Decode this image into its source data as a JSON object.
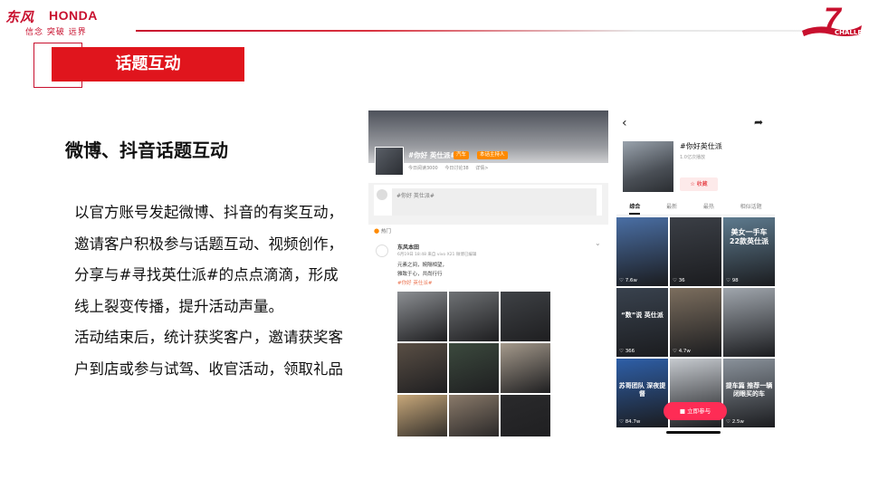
{
  "header": {
    "brand_cn": "东风",
    "brand_en": "HONDA",
    "slogan": "信念 突破 远界",
    "badge_number": "7",
    "badge_text": "CHALLENGE",
    "colors": {
      "brand_red": "#c8102e",
      "title_bar": "#e0151d"
    }
  },
  "title": {
    "label": "话题互动"
  },
  "content": {
    "subtitle": "微博、抖音话题互动",
    "paragraph1": "以官方账号发起微博、抖音的有奖互动，邀请客户积极参与话题互动、视频创作，分享与#寻找英仕派#的点点滴滴，形成线上裂变传播，提升活动声量。",
    "paragraph2": "活动结束后，统计获奖客户，邀请获奖客户到店或参与试驾、收官活动，领取礼品"
  },
  "weibo": {
    "topic": "#你好 英仕派#",
    "tag1": "汽车",
    "tag2": "本话主持人",
    "stats": "今日阅读3000 今日讨论38 详情>",
    "input_placeholder": "#你好 英仕派#",
    "hot_label": "热门",
    "post_user": "东风本田",
    "post_meta": "6月19日 18:48 来自 vivo X21 微博已编辑",
    "post_line1": "元素之间，婉隔相望，",
    "post_line2": "雅致于心，共尚行行",
    "post_link": "#你好 英仕派#",
    "photo_colors": [
      "#8c8f93",
      "#6f7275",
      "#3f4246",
      "#5a4f45",
      "#3c4a3e",
      "#a59a8c",
      "#c8a87a",
      "#8a7a6a",
      "#2a2a2c"
    ]
  },
  "douyin": {
    "back_icon": "chevron-left",
    "share_icon": "share",
    "topic": "#你好英仕派",
    "views": "1.0亿次播放",
    "fav_label": "收藏",
    "tabs": [
      "综合",
      "最新",
      "最热",
      "相似话题"
    ],
    "active_tab": "综合",
    "cells": [
      {
        "likes": "7.6w",
        "caption": "",
        "top_caption": "",
        "bg": "#4a6fa5"
      },
      {
        "likes": "36",
        "caption": "",
        "top_caption": "",
        "bg": "#3b3f46"
      },
      {
        "likes": "98",
        "caption": "",
        "top_caption": "美女一手车 22款英仕派",
        "bg": "#5e7b8f"
      },
      {
        "likes": "366",
        "caption": "“数”说 英仕派",
        "top_caption": "",
        "bg": "#39424e"
      },
      {
        "likes": "4.7w",
        "caption": "",
        "top_caption": "",
        "bg": "#7c6e5e"
      },
      {
        "likes": "",
        "caption": "",
        "top_caption": "",
        "bg": "#a0a6ad"
      },
      {
        "likes": "84.7w",
        "caption": "苏哥团队 深夜提督",
        "top_caption": "",
        "bg": "#2e5fa8"
      },
      {
        "likes": "",
        "caption": "",
        "top_caption": "",
        "bg": "#c5c9ce"
      },
      {
        "likes": "2.5w",
        "caption": "提车篇 推荐一辆闭眼买的车",
        "top_caption": "",
        "bg": "#8a929b"
      }
    ],
    "join_button": "立即参与"
  }
}
